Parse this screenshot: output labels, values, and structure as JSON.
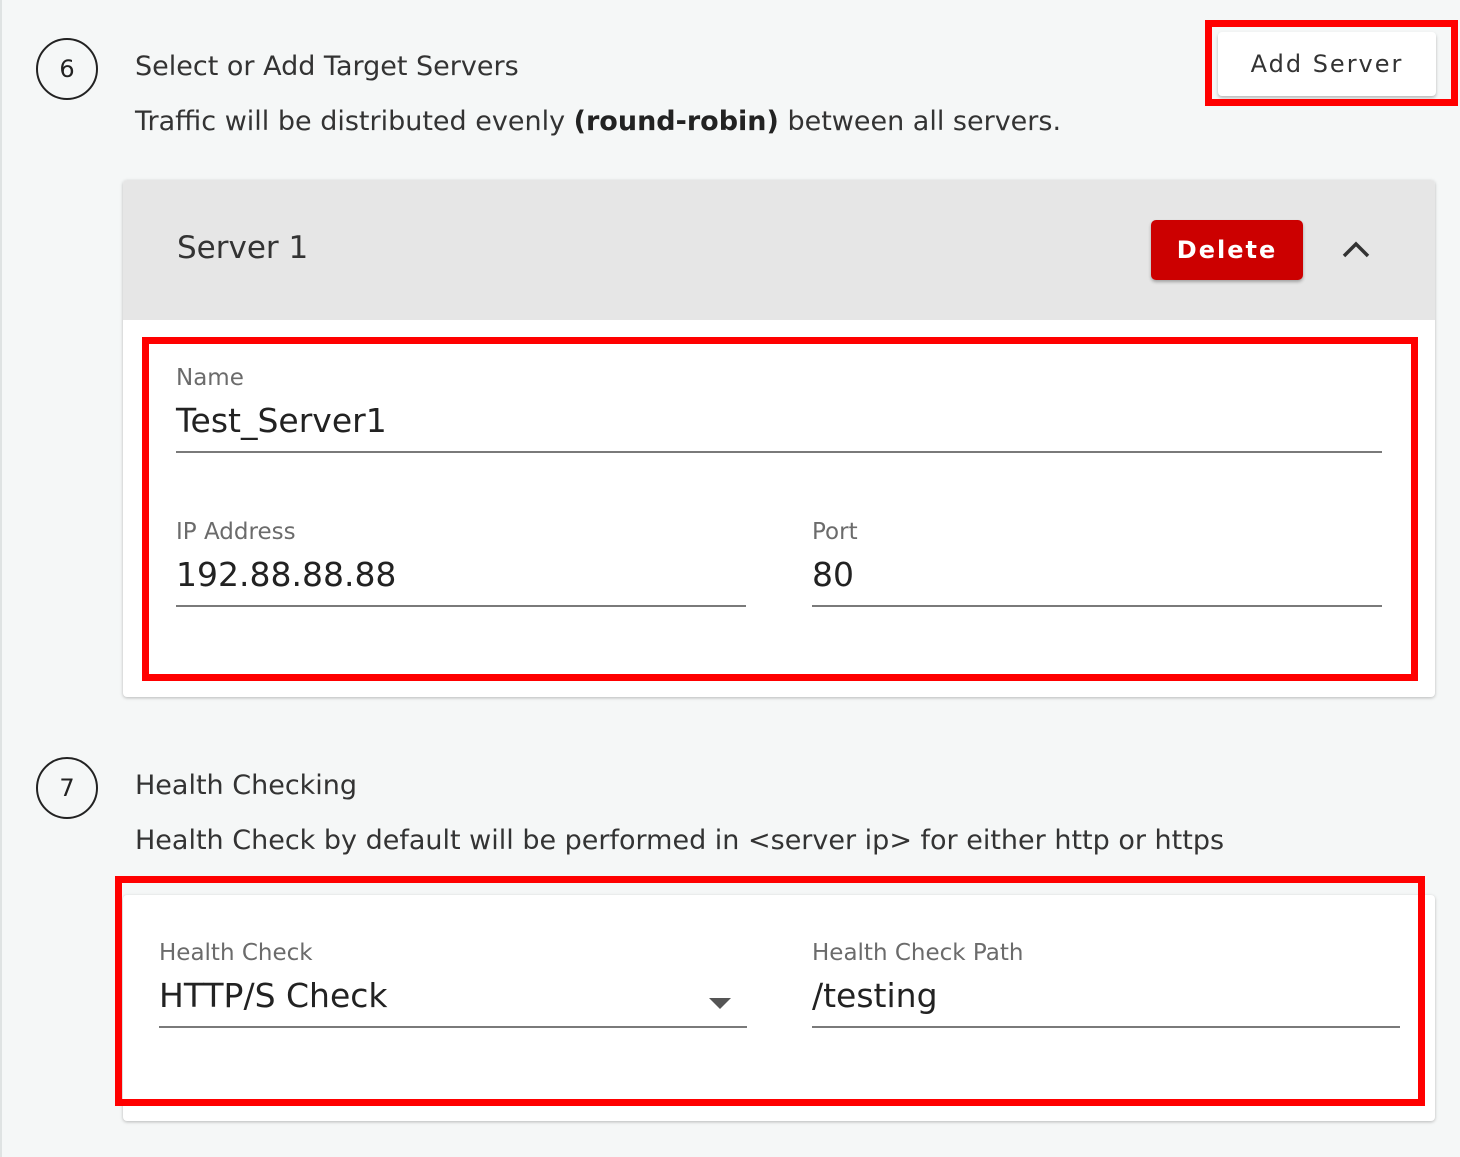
{
  "step6": {
    "number": "6",
    "title": "Select or Add Target Servers",
    "desc_prefix": "Traffic will be distributed evenly ",
    "desc_bold": "(round-robin)",
    "desc_suffix": " between all servers.",
    "add_server_label": "Add Server"
  },
  "server1": {
    "title": "Server 1",
    "delete_label": "Delete",
    "collapse_icon": "chevron-up-icon",
    "name": {
      "label": "Name",
      "value": "Test_Server1"
    },
    "ip": {
      "label": "IP Address",
      "value": "192.88.88.88"
    },
    "port": {
      "label": "Port",
      "value": "80"
    }
  },
  "step7": {
    "number": "7",
    "title": "Health Checking",
    "desc": "Health Check by default will be performed in <server ip> for either http or https",
    "health_check": {
      "label": "Health Check",
      "value": "HTTP/S Check",
      "icon": "dropdown-arrow-icon"
    },
    "health_check_path": {
      "label": "Health Check Path",
      "value": "/testing"
    }
  },
  "colors": {
    "highlight": "#ff0000",
    "delete": "#cc0000",
    "header_bg": "#e6e6e6",
    "page_bg": "#f5f7f7"
  }
}
